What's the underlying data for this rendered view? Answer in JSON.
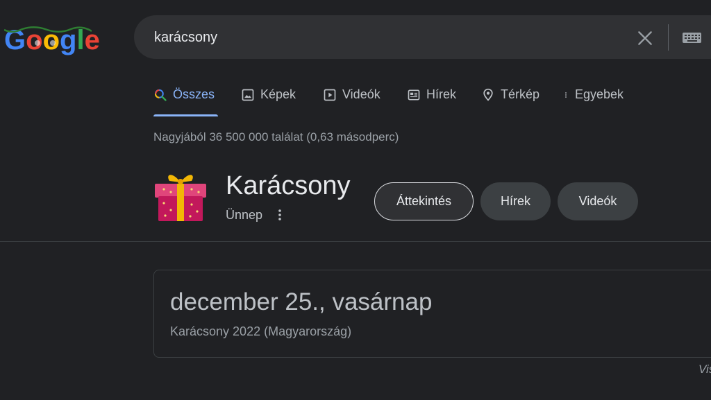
{
  "logo": {
    "letters": [
      "G",
      "o",
      "o",
      "g",
      "l",
      "e"
    ]
  },
  "search": {
    "query": "karácsony"
  },
  "tabs": [
    {
      "label": "Összes",
      "icon": "search-icon",
      "active": true
    },
    {
      "label": "Képek",
      "icon": "image-icon"
    },
    {
      "label": "Videók",
      "icon": "video-icon"
    },
    {
      "label": "Hírek",
      "icon": "news-icon"
    },
    {
      "label": "Térkép",
      "icon": "map-pin-icon"
    },
    {
      "label": "Egyebek",
      "icon": "more-vert-icon"
    }
  ],
  "result_stats": "Nagyjából 36 500 000 találat (0,63 másodperc)",
  "knowledge": {
    "title": "Karácsony",
    "subtitle": "Ünnep",
    "chips": [
      "Áttekintés",
      "Hírek",
      "Videók"
    ]
  },
  "date_card": {
    "date": "december 25., vasárnap",
    "caption": "Karácsony 2022 (Magyarország)"
  },
  "footer": {
    "partial_link": "Vis"
  },
  "colors": {
    "background": "#202124",
    "search_box": "#303134",
    "accent": "#8ab4f8",
    "gift_red": "#c2185b",
    "ribbon_gold": "#f2b705"
  }
}
